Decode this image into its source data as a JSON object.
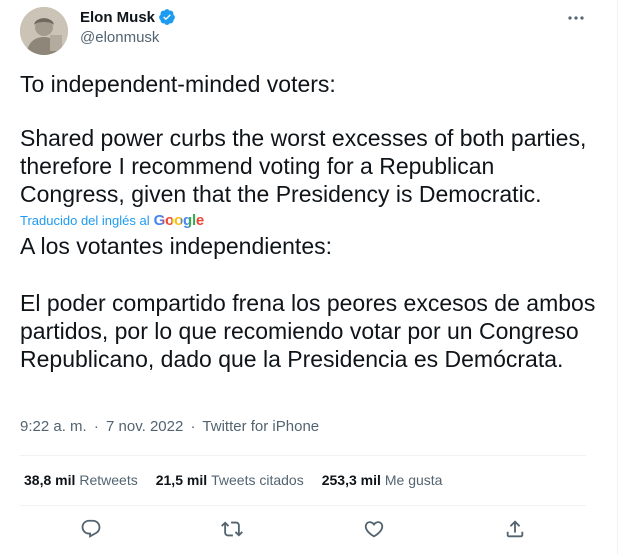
{
  "author": {
    "display_name": "Elon Musk",
    "handle": "@elonmusk"
  },
  "tweet": {
    "text_intro": "To independent-minded voters:",
    "text_body": "Shared power curbs the worst excesses of both parties, therefore I recommend voting for a Republican Congress, given that the Presidency is Democratic.",
    "translated_label": "Traducido del inglés al",
    "translator_brand": "Google",
    "translation_intro": "A los votantes independientes:",
    "translation_body": "El poder compartido frena los peores excesos de ambos partidos, por lo que recomiendo votar por un Congreso Republicano, dado que la Presidencia es Demócrata."
  },
  "meta": {
    "time": "9:22 a. m.",
    "separator": "·",
    "date": "7 nov. 2022",
    "source": "Twitter for iPhone"
  },
  "stats": {
    "retweets_count": "38,8 mil",
    "retweets_label": "Retweets",
    "quotes_count": "21,5 mil",
    "quotes_label": "Tweets citados",
    "likes_count": "253,3 mil",
    "likes_label": "Me gusta"
  },
  "icons": {
    "verified": "verified-badge-icon",
    "more": "more-options-icon",
    "reply": "reply-icon",
    "retweet": "retweet-icon",
    "like": "like-icon",
    "share": "share-icon"
  },
  "colors": {
    "accent": "#1d9bf0",
    "text": "#0f1419",
    "secondary": "#536471",
    "border": "#eff3f4"
  }
}
